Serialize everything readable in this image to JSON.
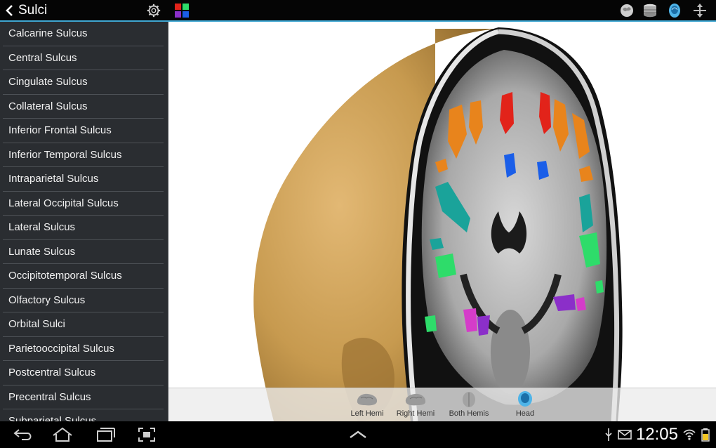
{
  "header": {
    "title": "Sulci"
  },
  "sidebar": {
    "items": [
      {
        "label": "Calcarine Sulcus"
      },
      {
        "label": "Central Sulcus"
      },
      {
        "label": "Cingulate Sulcus"
      },
      {
        "label": "Collateral Sulcus"
      },
      {
        "label": "Inferior Frontal Sulcus"
      },
      {
        "label": "Inferior Temporal Sulcus"
      },
      {
        "label": "Intraparietal Sulcus"
      },
      {
        "label": "Lateral Occipital Sulcus"
      },
      {
        "label": "Lateral Sulcus"
      },
      {
        "label": "Lunate Sulcus"
      },
      {
        "label": "Occipitotemporal Sulcus"
      },
      {
        "label": "Olfactory Sulcus"
      },
      {
        "label": "Orbital Sulci"
      },
      {
        "label": "Parietooccipital Sulcus"
      },
      {
        "label": "Postcentral Sulcus"
      },
      {
        "label": "Precentral Sulcus"
      },
      {
        "label": "Subparietal Sulcus"
      }
    ]
  },
  "dock": {
    "left_hemi": "Left Hemi",
    "right_hemi": "Right Hemi",
    "both_hemis": "Both Hemis",
    "head": "Head"
  },
  "status": {
    "time": "12:05"
  },
  "colors": {
    "accent": "#3fa7d2",
    "sidebar_bg": "#2a2d31",
    "skin": "#c79a4f",
    "sulcus_orange": "#e8841c",
    "sulcus_red": "#e2231a",
    "sulcus_blue": "#1a5ee8",
    "sulcus_teal": "#1aa39a",
    "sulcus_green": "#2edc6a",
    "sulcus_purple": "#8b2fc9",
    "sulcus_magenta": "#d53cc9"
  }
}
